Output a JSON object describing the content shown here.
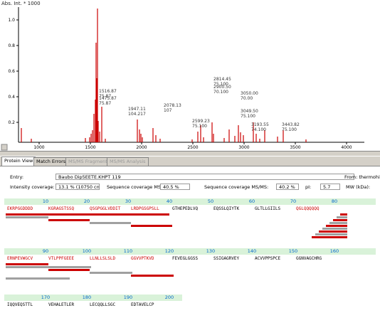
{
  "spectrum": {
    "axis_label": "Abs. Int. * 1000",
    "y_ticks": [
      "1.0",
      "0.8",
      "0.6",
      "0.4",
      "0.2"
    ],
    "x_ticks": [
      "1000",
      "1500",
      "2000",
      "2500",
      "3000",
      "3500",
      "4000"
    ],
    "peak_labels": [
      {
        "mass": "1516.87",
        "ann": "75.87"
      },
      {
        "mass": "1475.87",
        "ann": "75.87"
      },
      {
        "mass": "1947.11",
        "ann": "104.217"
      },
      {
        "mass": "2078.13",
        "ann": "107"
      },
      {
        "mass": "2814.45",
        "ann": "75.100"
      },
      {
        "mass": "2900.50",
        "ann": "70.100"
      },
      {
        "mass": "2599.23",
        "ann": "75.100"
      },
      {
        "mass": "3050.00",
        "ann": "70.00"
      },
      {
        "mass": "3049.50",
        "ann": "75.100"
      },
      {
        "mass": "3193.55",
        "ann": "74.100"
      },
      {
        "mass": "3443.82",
        "ann": "75.100"
      }
    ]
  },
  "tabs": [
    "Protein View",
    "Match Errors",
    "MS/MS Fragments",
    "MS/MS Analysis"
  ],
  "protein": {
    "entry_label": "Entry:",
    "entry_value": "Baubo Dip5EETE.KHPT 119",
    "entry_right": "From: thermohit",
    "intensity_label": "Intensity coverage:",
    "intensity_value": "13.1 % (10750 cnts)",
    "seq_cov_ms_label": "Sequence coverage MS:",
    "seq_cov_ms_value": "40.5 %",
    "seq_cov_msms_label": "Sequence coverage MS/MS:",
    "seq_cov_msms_value": "40.2 %",
    "pi_label": "pI:",
    "pi_value": "5.7",
    "mw_label": "MW (kDa):"
  },
  "rows": [
    {
      "numbers": [
        "10",
        "20",
        "30",
        "40",
        "50",
        "60",
        "70",
        "80"
      ],
      "segments": [
        "EKRPGGDDDD",
        "KGRAGSTSSQ",
        "QSGPGGLVDDIT",
        "LRDPGSGPSLL",
        "GTHEPEDLVQ",
        "EQSSLQIYTK",
        "GLTLLGIILS",
        "QGLQQQQQQ"
      ],
      "covered": [
        true,
        true,
        true,
        true,
        false,
        false,
        false,
        true
      ]
    },
    {
      "numbers": [
        "90",
        "100",
        "110",
        "120",
        "130",
        "140",
        "150",
        "160"
      ],
      "segments": [
        "ERNPEVWGCV",
        "VTLPPFGEEE",
        "LLNLLSLSLD",
        "GGVVPTKVD",
        "FEVEGLGGSS",
        "SSIGAGRVEY",
        "ACVVPPSPCE",
        "GGNVAGCHRG"
      ],
      "covered": [
        true,
        true,
        true,
        true,
        false,
        false,
        false,
        false
      ]
    },
    {
      "numbers": [
        "170",
        "180",
        "190",
        "200"
      ],
      "segments": [
        "IQQVEQSTTL",
        "VEHALETLER",
        "LECQQLLSGC",
        "EDTAVELCP"
      ],
      "covered": [
        false,
        false,
        false,
        false
      ]
    }
  ]
}
